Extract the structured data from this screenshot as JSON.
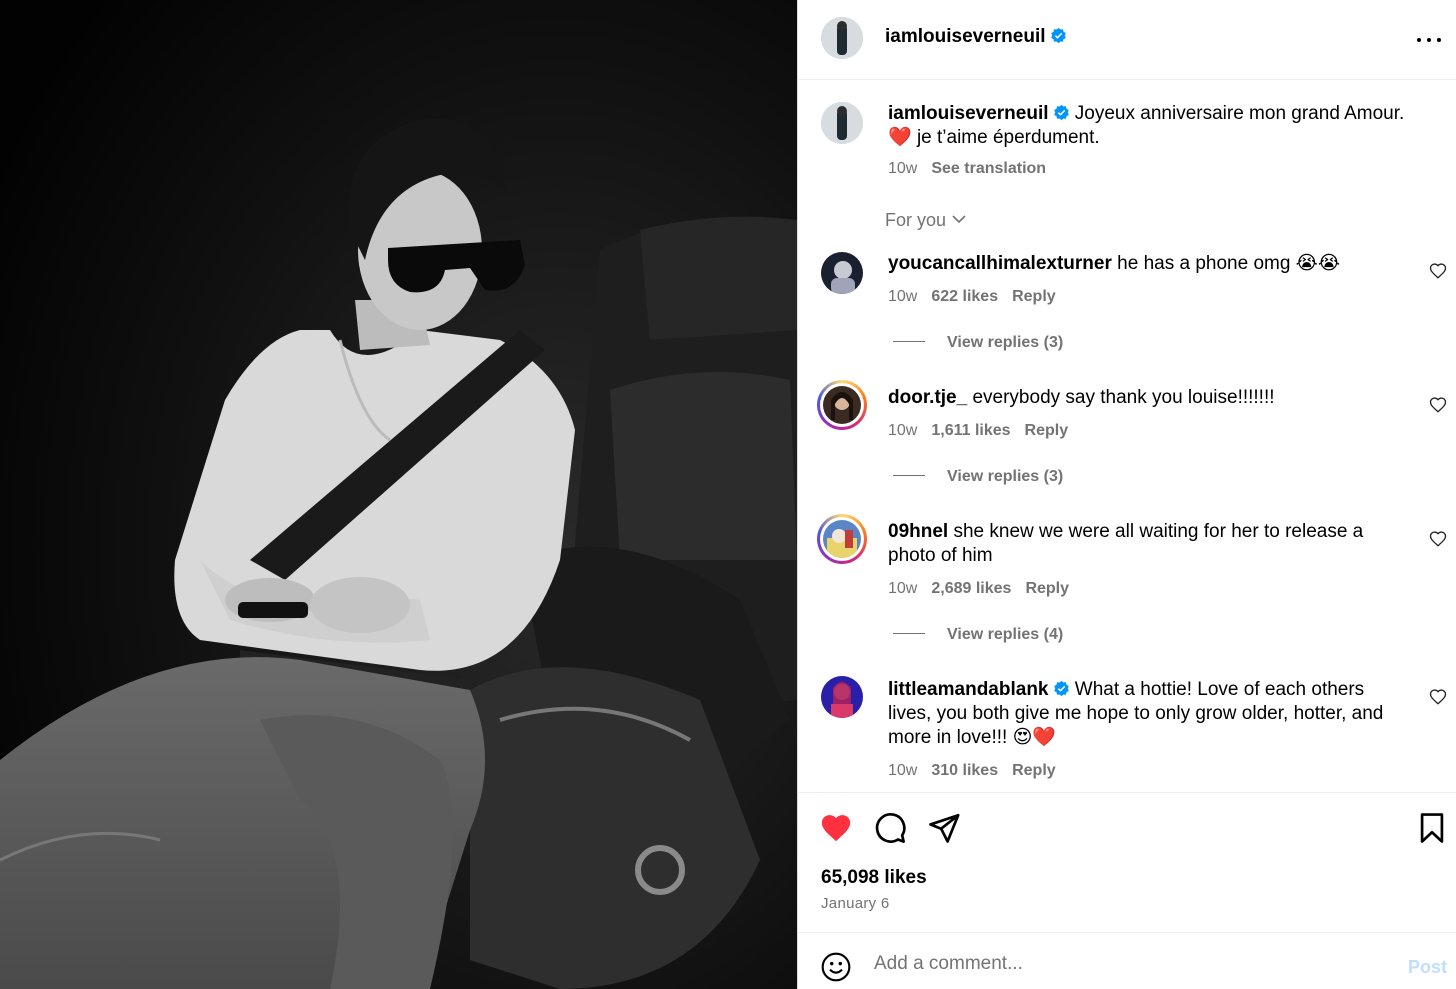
{
  "post": {
    "author": "iamlouiseverneuil",
    "caption_line1": "Joyeux anniversaire mon grand Amour.",
    "caption_line2": "je t’aime éperdument.",
    "caption_heart": "❤️",
    "time": "10w",
    "see_translation": "See translation",
    "for_you": "For you",
    "likes": "65,098 likes",
    "date": "January 6"
  },
  "comments": [
    {
      "user": "youcancallhimalexturner",
      "verified": false,
      "text": "he has a phone omg 😭😭",
      "time": "10w",
      "likes": "622 likes",
      "reply": "Reply",
      "view_replies": "View replies (3)"
    },
    {
      "user": "door.tje_",
      "verified": false,
      "text": "everybody say thank you louise!!!!!!!",
      "time": "10w",
      "likes": "1,611 likes",
      "reply": "Reply",
      "view_replies": "View replies (3)"
    },
    {
      "user": "09hnel",
      "verified": false,
      "text": "she knew we were all waiting for her to release a photo of him",
      "time": "10w",
      "likes": "2,689 likes",
      "reply": "Reply",
      "view_replies": "View replies (4)"
    },
    {
      "user": "littleamandablank",
      "verified": true,
      "text": "What a hottie! Love of each others lives, you both give me hope to only grow older, hotter, and more in love!!! 😍❤️",
      "time": "10w",
      "likes": "310 likes",
      "reply": "Reply"
    }
  ],
  "add_comment": {
    "placeholder": "Add a comment...",
    "post_label": "Post"
  },
  "icons": {
    "like": "heart-filled-icon",
    "comment": "comment-icon",
    "share": "send-icon",
    "save": "bookmark-icon",
    "more": "more-options-icon",
    "verified": "verified-badge-icon",
    "emoji": "emoji-icon"
  },
  "colors": {
    "like_red": "#ff3040",
    "verified_blue": "#0095f6",
    "post_disabled": "#c0dffd",
    "secondary_text": "#737373"
  }
}
